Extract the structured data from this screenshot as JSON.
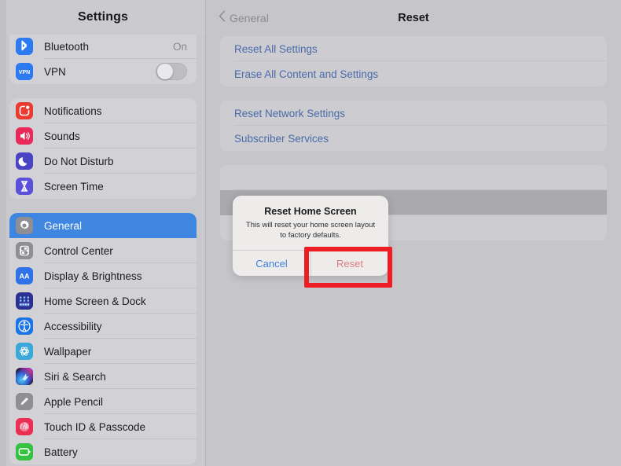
{
  "sidebar": {
    "title": "Settings",
    "groups": [
      {
        "name": "connectivity",
        "rows": [
          {
            "label": "Bluetooth",
            "icon": "bluetooth-icon",
            "value": "On",
            "accessory": "value"
          },
          {
            "label": "VPN",
            "icon": "vpn-icon",
            "accessory": "toggle-off"
          }
        ]
      },
      {
        "name": "notifications",
        "rows": [
          {
            "label": "Notifications",
            "icon": "notifications-icon",
            "accessory": "none"
          },
          {
            "label": "Sounds",
            "icon": "sounds-icon",
            "accessory": "none"
          },
          {
            "label": "Do Not Disturb",
            "icon": "do-not-disturb-icon",
            "accessory": "none"
          },
          {
            "label": "Screen Time",
            "icon": "screen-time-icon",
            "accessory": "none"
          }
        ]
      },
      {
        "name": "system",
        "rows": [
          {
            "label": "General",
            "icon": "gear-icon",
            "accessory": "none",
            "selected": true
          },
          {
            "label": "Control Center",
            "icon": "control-center-icon",
            "accessory": "none"
          },
          {
            "label": "Display & Brightness",
            "icon": "display-brightness-icon",
            "accessory": "none"
          },
          {
            "label": "Home Screen & Dock",
            "icon": "home-screen-dock-icon",
            "accessory": "none"
          },
          {
            "label": "Accessibility",
            "icon": "accessibility-icon",
            "accessory": "none"
          },
          {
            "label": "Wallpaper",
            "icon": "wallpaper-icon",
            "accessory": "none"
          },
          {
            "label": "Siri & Search",
            "icon": "siri-search-icon",
            "accessory": "none"
          },
          {
            "label": "Apple Pencil",
            "icon": "apple-pencil-icon",
            "accessory": "none"
          },
          {
            "label": "Touch ID & Passcode",
            "icon": "touch-id-passcode-icon",
            "accessory": "none"
          },
          {
            "label": "Battery",
            "icon": "battery-icon",
            "accessory": "none"
          }
        ]
      }
    ]
  },
  "detail": {
    "back_label": "General",
    "back_icon": "chevron-left-icon",
    "title": "Reset",
    "groups": [
      {
        "name": "reset-primary",
        "rows": [
          {
            "label": "Reset All Settings"
          },
          {
            "label": "Erase All Content and Settings"
          }
        ]
      },
      {
        "name": "reset-network",
        "rows": [
          {
            "label": "Reset Network Settings"
          },
          {
            "label": "Subscriber Services"
          }
        ]
      },
      {
        "name": "reset-layout",
        "rows": [
          {
            "label": ""
          },
          {
            "label": "",
            "pressed": true
          },
          {
            "label": ""
          }
        ]
      }
    ]
  },
  "alert": {
    "title": "Reset Home Screen",
    "message": "This will reset your home screen layout to factory defaults.",
    "cancel_label": "Cancel",
    "confirm_label": "Reset"
  },
  "annotation": {
    "highlight_color": "#ee1c23",
    "target": "Reset"
  },
  "colors": {
    "selection_blue": "#3e86e0",
    "link_blue": "#4a6aa8",
    "destructive_red": "#dd7d7d",
    "panel_gray": "#c6c6ca",
    "group_gray": "#cdcdd1"
  }
}
